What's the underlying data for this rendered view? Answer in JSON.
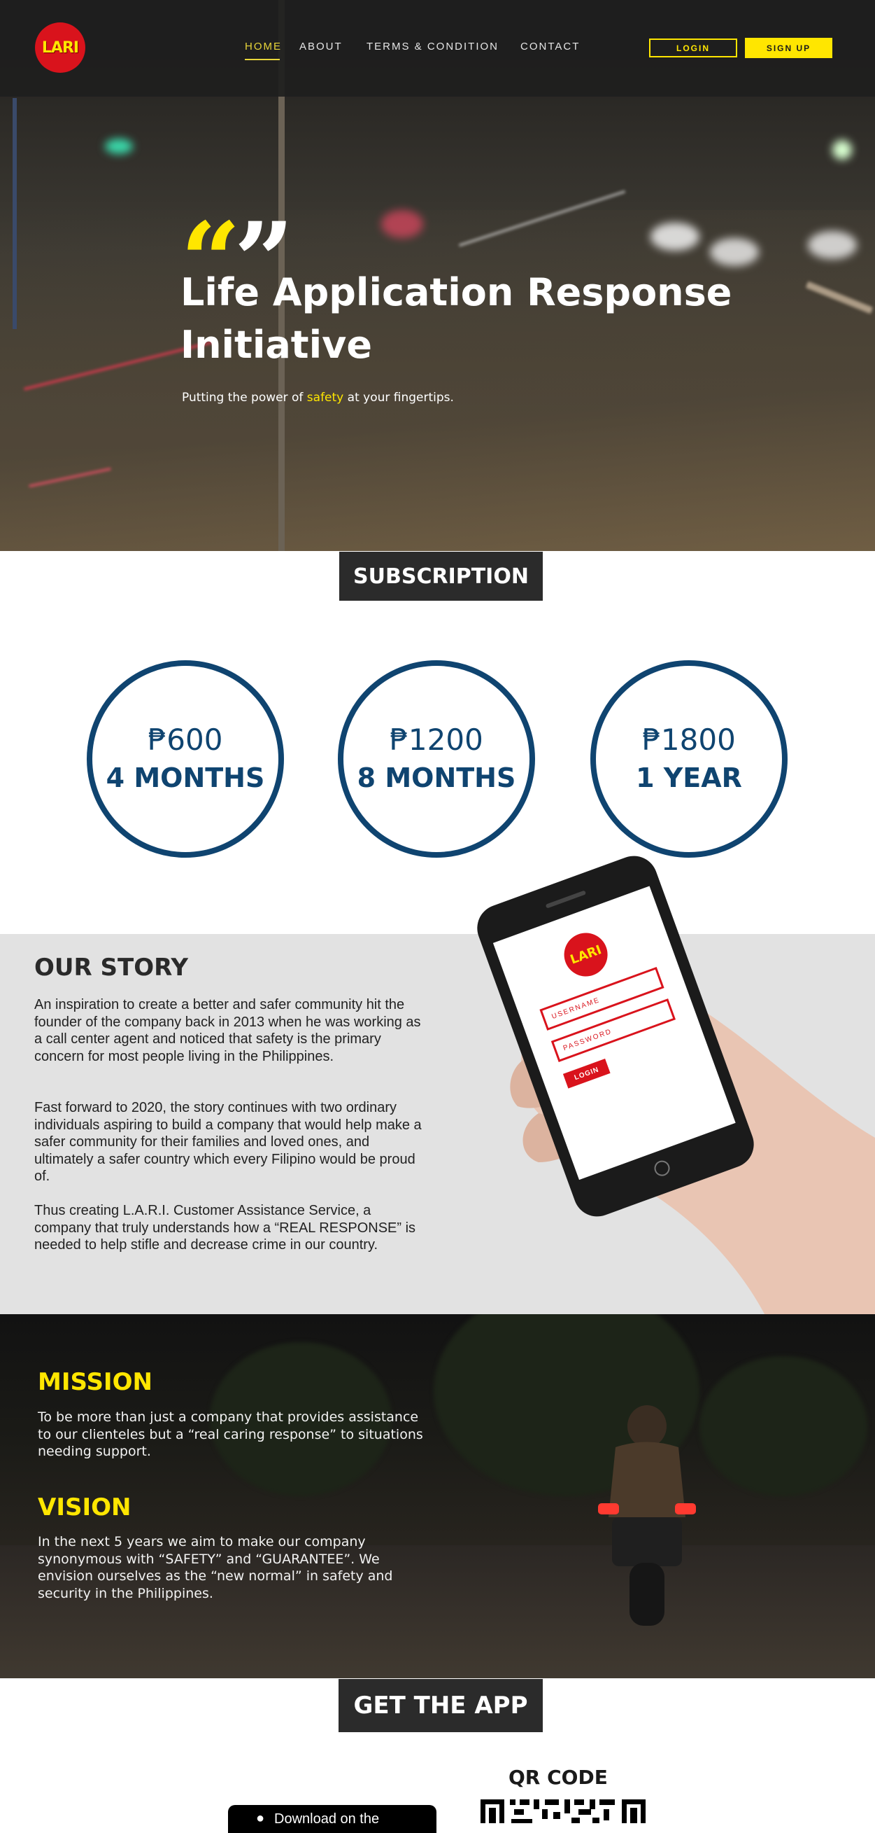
{
  "brand": {
    "logo_text": "LARI"
  },
  "nav": {
    "links": [
      "HOME",
      "ABOUT",
      "TERMS & CONDITION",
      "CONTACT"
    ],
    "login_label": "LOGIN",
    "signup_label": "SIGN UP"
  },
  "hero": {
    "title": "Life Application Response Initiative",
    "subtitle_before": "Putting the power of ",
    "subtitle_highlight": "safety",
    "subtitle_after": " at your fingertips."
  },
  "subscription": {
    "heading": "SUBSCRIPTION",
    "plans": [
      {
        "price": "₱600",
        "duration": "4 MONTHS"
      },
      {
        "price": "₱1200",
        "duration": "8 MONTHS"
      },
      {
        "price": "₱1800",
        "duration": "1 YEAR"
      }
    ]
  },
  "story": {
    "heading": "OUR STORY",
    "paragraphs": [
      "An inspiration to create a better and safer community hit the founder of the company back in 2013 when he was working as a call center agent and noticed that safety is the primary concern for most people living in the Philippines.",
      "Fast forward to 2020, the story continues with two ordinary individuals aspiring to build a company that would help make a safer community for their families and loved ones, and ultimately a safer country which every Filipino would be proud of.",
      "Thus creating L.A.R.I. Customer Assistance Service, a company that truly understands how a “REAL RESPONSE” is needed to help stifle and decrease crime in our country."
    ],
    "phone": {
      "logo_text": "LARI",
      "username_label": "USERNAME",
      "password_label": "PASSWORD",
      "login_label": "LOGIN"
    }
  },
  "mission": {
    "heading": "MISSION",
    "text": "To be more than just a company that provides assistance to our clienteles but a “real caring response” to situations needing support."
  },
  "vision": {
    "heading": "VISION",
    "text": "In the next 5 years we aim to make our company synonymous with “SAFETY” and “GUARANTEE”. We envision ourselves as the “new normal” in safety and security in the Philippines."
  },
  "get_app": {
    "heading": "GET THE APP",
    "qr_heading": "QR CODE",
    "appstore_label": "Download on the"
  },
  "colors": {
    "accent_yellow": "#ffe600",
    "brand_red": "#d9131c",
    "price_blue": "#0f4470",
    "dark": "#2b2b2b"
  }
}
